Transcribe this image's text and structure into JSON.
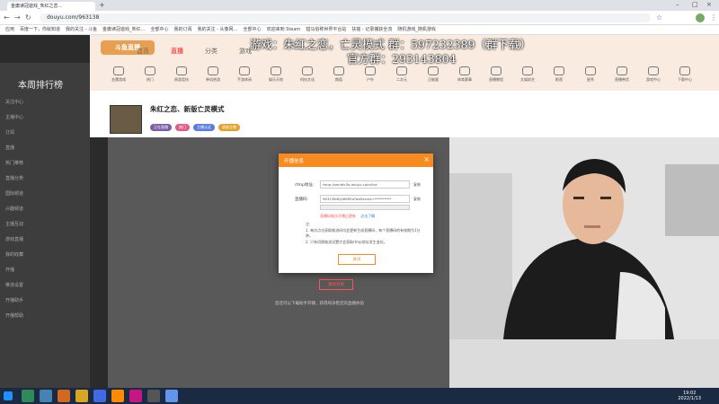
{
  "browser": {
    "tab_title": "金庸读冠遊戏_朱红之恋…",
    "url": "douyu.com/963138",
    "bookmarks": [
      "应用",
      "百度一下，你就知道",
      "我的关注 - 斗鱼",
      "金庸读冠遊戏_朱红…",
      "全部中心",
      "我的订阅",
      "我的关注 - 头像网…",
      "全部中心",
      "欢迎来到 Steam",
      "猎马俗称世界平台站",
      "扶摇 - 记录捕获全流",
      "随机游戏_随机游戏"
    ]
  },
  "site": {
    "logo_text": "斗鱼直播",
    "nav": [
      "首页",
      "直播",
      "分类",
      "游戏"
    ],
    "categories": [
      "金庸游戏",
      "热门",
      "网游竞技",
      "单机热游",
      "手游休闲",
      "娱乐天地",
      "科技文化",
      "颜值",
      "户外",
      "二次元",
      "正能量",
      "体育赛事",
      "直播教程",
      "文娱综艺",
      "影视",
      "星秀",
      "直播带货",
      "游戏中心",
      "下载中心"
    ]
  },
  "overlay": {
    "line1": "游戏：朱红之恋，亡灵模式  群：597232389（群下载）",
    "line2": "官方群：293143804"
  },
  "sidebar": {
    "heading": "本周排行榜",
    "items": [
      "关注中心",
      "主播中心",
      "订阅",
      "直播",
      "热门推荐",
      "直播分类",
      "国际频道",
      "兴趣频道",
      "主播互动",
      "游戏直播",
      "我的收藏",
      "开播",
      "推流设置",
      "开播助手",
      "开播帮助"
    ]
  },
  "room": {
    "title": "朱红之恋、新版亡灵模式",
    "badges": [
      "正在直播",
      "热门",
      "主播认证",
      "星级主播"
    ]
  },
  "modal": {
    "title": "开播信息",
    "rtmp_label": "rtmp地址:",
    "rtmp_value": "rtmp://sendtc3a.douyu.com/live",
    "key_label": "直播码:",
    "key_value": "963138rBjQ89ff5a?wsSecret=**********",
    "copy_label": "复制",
    "warn": "直播码每次开播后更新",
    "learn_more": "点击了解",
    "note_title": "注:",
    "notes": [
      "1. 每次点击获取推流码均会更新生成直播码，每个直播码的有效期为1分钟。",
      "2. 只有切换推流设置才会获取rtmp地址发生变化。"
    ],
    "ok_button": "关闭"
  },
  "player": {
    "play_again": "重新开始",
    "message": "您还可以下载助手开播，获得纯净稳定的直播体验"
  },
  "taskbar": {
    "time": "19:02",
    "date": "2022/1/13"
  },
  "colors": {
    "accent": "#f78b1f",
    "taskbar": "#1b2a43",
    "player_bg": "#595959"
  }
}
